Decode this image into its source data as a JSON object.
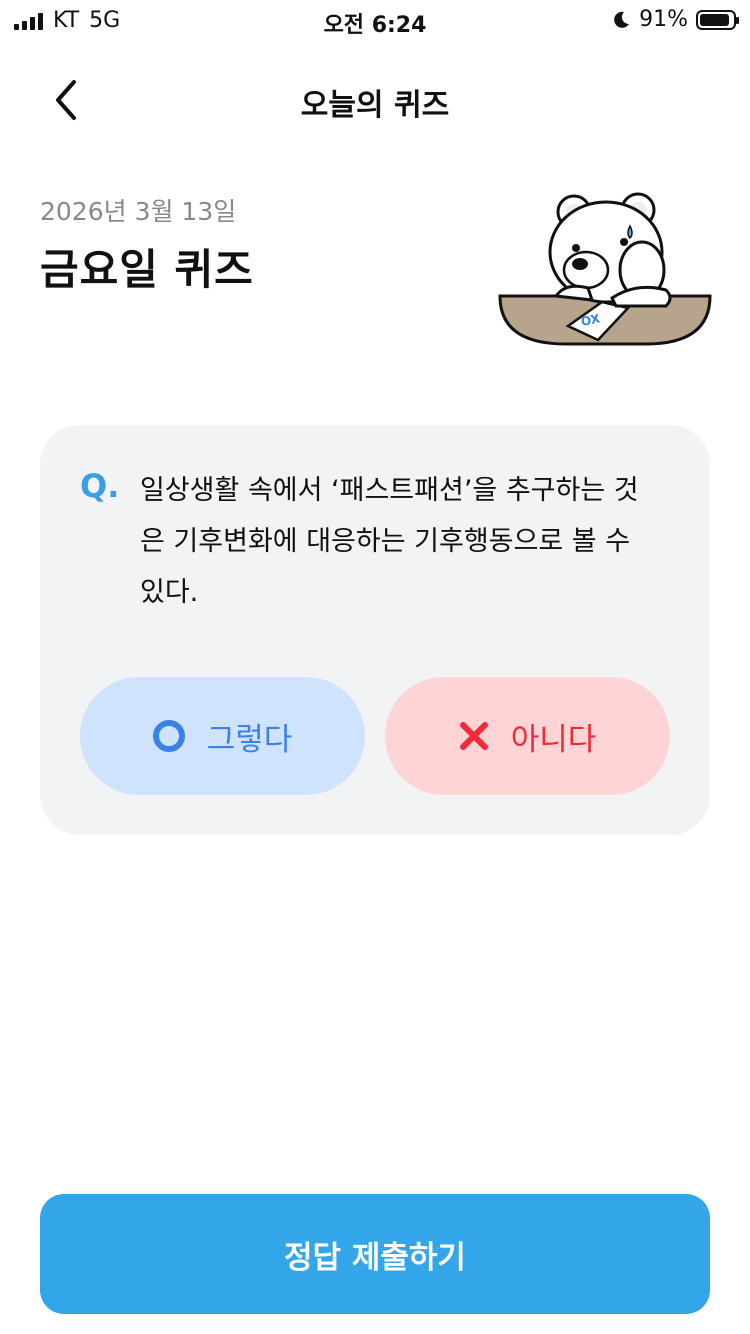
{
  "status_bar": {
    "carrier": "KT",
    "network": "5G",
    "time": "오전 6:24",
    "battery": "91%",
    "battery_level": 0.91
  },
  "nav": {
    "title": "오늘의 퀴즈",
    "back_icon": "chevron-left-icon"
  },
  "quiz": {
    "date": "2026년 3월 13일",
    "heading": "금요일 퀴즈",
    "question_prefix": "Q.",
    "question": "일상생활 속에서 ‘패스트패션’을 추구하는 것은 기후변화에 대응하는 기후행동으로 볼 수 있다.",
    "options": {
      "yes_label": "그렇다",
      "no_label": "아니다",
      "yes_icon": "circle-o-icon",
      "no_icon": "x-icon"
    },
    "mascot_card_text": "OX"
  },
  "submit_label": "정답 제출하기",
  "colors": {
    "accent": "#33a5e9",
    "yes_bg": "#cfe3fd",
    "yes_fg": "#3b82e8",
    "no_bg": "#ffd4d6",
    "no_fg": "#ef2b3a",
    "card_bg": "#f2f3f5"
  }
}
